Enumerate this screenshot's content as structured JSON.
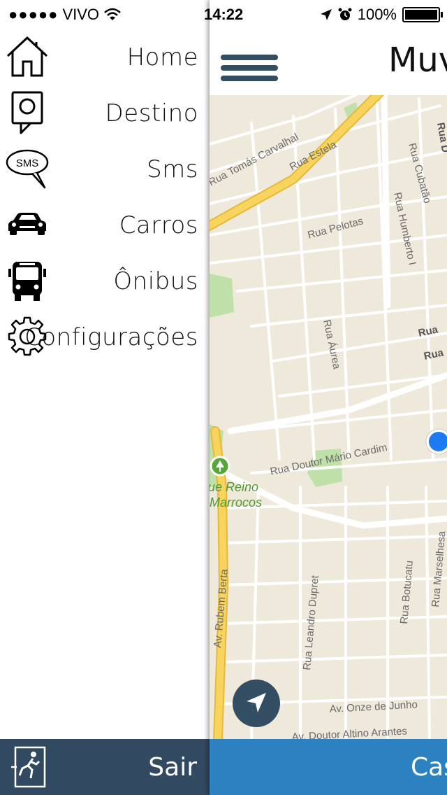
{
  "status_bar": {
    "signal_dots": "●●●●●",
    "carrier": "VIVO",
    "time": "14:22",
    "battery_percent": "100%",
    "icons": [
      "wifi-icon",
      "location-arrow-icon",
      "alarm-icon",
      "battery-icon"
    ]
  },
  "drawer": {
    "items": [
      {
        "label": "Home",
        "icon": "home-icon"
      },
      {
        "label": "Destino",
        "icon": "map-pin-icon"
      },
      {
        "label": "Sms",
        "icon": "sms-bubble-icon"
      },
      {
        "label": "Carros",
        "icon": "car-icon"
      },
      {
        "label": "Ônibus",
        "icon": "bus-icon"
      },
      {
        "label": "Configurações",
        "icon": "gear-icon"
      }
    ],
    "logout": {
      "label": "Sair",
      "icon": "exit-icon"
    }
  },
  "header": {
    "title": "Muv",
    "menu_icon": "hamburger-menu-icon"
  },
  "map": {
    "street_labels": [
      "Rua Tomás Carvalhal",
      "Rua Estela",
      "Rua Cubatão",
      "Rua Pelotas",
      "Rua Humberto I",
      "Rua Áurea",
      "Rua Doutor Mário Cardim",
      "Av. Rubem Berta",
      "Rua Leandro Dupret",
      "Rua Botucatu",
      "Rua Marselhesa",
      "Av. Onze de Junho",
      "Av. Doutor Altino Arantes",
      "Rua",
      "Rua",
      "Rua D"
    ],
    "park_label_line1": "ue Reino",
    "park_label_line2": "Marrocos",
    "locate_icon": "navigation-arrow-icon"
  },
  "bottom_bar": {
    "label": "Casa"
  },
  "colors": {
    "sidebar_footer": "#324a61",
    "bottom_bar": "#2c82c0",
    "accent_dark": "#334d63",
    "map_bg": "#efe9dc",
    "highway": "#f7d45e",
    "park": "#bfe0a8",
    "user_dot": "#1e7af2"
  }
}
